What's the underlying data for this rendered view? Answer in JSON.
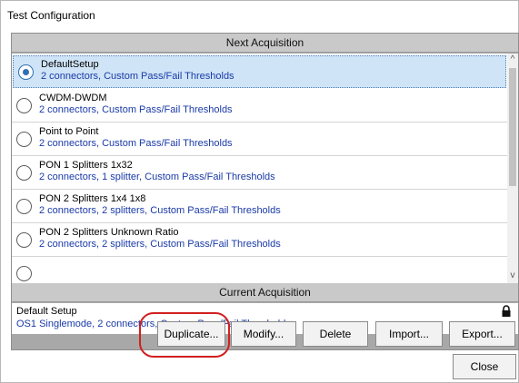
{
  "window": {
    "title": "Test Configuration"
  },
  "next_acquisition": {
    "header": "Next Acquisition",
    "items": [
      {
        "name": "DefaultSetup",
        "desc": "2 connectors, Custom Pass/Fail Thresholds",
        "selected": true
      },
      {
        "name": "CWDM-DWDM",
        "desc": "2 connectors, Custom Pass/Fail Thresholds",
        "selected": false
      },
      {
        "name": "Point to Point",
        "desc": "2 connectors, Custom Pass/Fail Thresholds",
        "selected": false
      },
      {
        "name": "PON 1 Splitters 1x32",
        "desc": "2 connectors, 1 splitter, Custom Pass/Fail Thresholds",
        "selected": false
      },
      {
        "name": "PON 2 Splitters 1x4 1x8",
        "desc": "2 connectors, 2 splitters, Custom Pass/Fail Thresholds",
        "selected": false
      },
      {
        "name": "PON 2 Splitters Unknown Ratio",
        "desc": "2 connectors, 2 splitters, Custom Pass/Fail Thresholds",
        "selected": false
      }
    ]
  },
  "current_acquisition": {
    "header": "Current Acquisition",
    "name": "Default Setup",
    "desc": "OS1 Singlemode, 2 connectors, Custom Pass/Fail Thresholds"
  },
  "buttons": {
    "duplicate": "Duplicate...",
    "modify": "Modify...",
    "delete": "Delete",
    "import": "Import...",
    "export": "Export...",
    "close": "Close"
  },
  "icons": {
    "lock": "lock-icon",
    "scroll_up": "chevron-up-icon",
    "scroll_down": "chevron-down-icon"
  },
  "colors": {
    "selection": "#cfe4f7",
    "description_text": "#1a3aa8",
    "highlight_ring": "#d21f1f",
    "panel_gray": "#a8a8a8"
  }
}
